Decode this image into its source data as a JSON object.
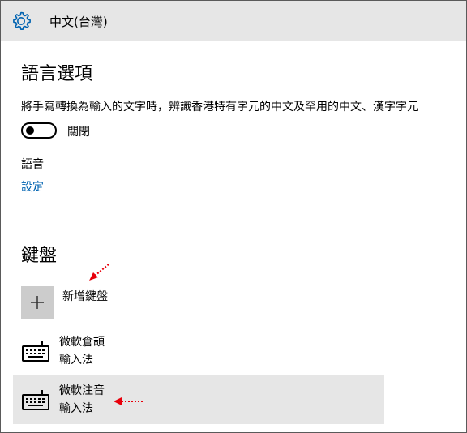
{
  "window": {
    "title": "中文(台灣)"
  },
  "language_options": {
    "heading": "語言選項",
    "description": "將手寫轉換為輸入的文字時，辨識香港特有字元的中文及罕用的中文、漢字字元",
    "toggle_state_label": "關閉",
    "toggle_on": false
  },
  "speech": {
    "label": "語音",
    "settings_link": "設定"
  },
  "keyboards": {
    "heading": "鍵盤",
    "add_label": "新增鍵盤",
    "items": [
      {
        "line1": "微軟倉頡",
        "line2": "輸入法",
        "selected": false
      },
      {
        "line1": "微軟注音",
        "line2": "輸入法",
        "selected": true
      }
    ]
  },
  "icons": {
    "settings": "gear-icon",
    "add": "plus-icon",
    "keyboard": "keyboard-icon",
    "annotation": "red-dotted-arrow"
  },
  "colors": {
    "titlebar_bg": "#e6e6e6",
    "link": "#0063b1",
    "gear": "#0063b1",
    "selected_bg": "#e6e6e6",
    "add_tile": "#cccccc",
    "annotation_arrow": "#e8000b"
  }
}
